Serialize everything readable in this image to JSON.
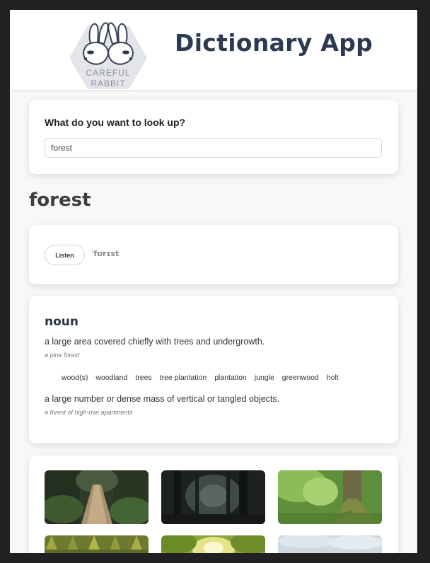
{
  "header": {
    "logo": {
      "top_text": "CAREFUL",
      "bottom_text": "RABBIT"
    },
    "title": "Dictionary App"
  },
  "search": {
    "label": "What do you want to look up?",
    "value": "forest"
  },
  "result": {
    "word": "forest",
    "listen_label": "Listen",
    "phonetic": "ˈfɒrɪst",
    "part_of_speech": "noun",
    "definitions": [
      {
        "text": "a large area covered chiefly with trees and undergrowth.",
        "example": "a pine forest"
      },
      {
        "text": "a large number or dense mass of vertical or tangled objects.",
        "example": "a forest of high-rise apartments"
      }
    ],
    "synonyms": [
      "wood(s)",
      "woodland",
      "trees",
      "tree plantation",
      "plantation",
      "jungle",
      "greenwood",
      "holt"
    ]
  },
  "images": [
    {
      "name": "forest-boardwalk-photo"
    },
    {
      "name": "dark-misty-forest-photo"
    },
    {
      "name": "mossy-tree-roots-photo"
    },
    {
      "name": "pine-treetops-photo"
    },
    {
      "name": "sunlit-canopy-photo"
    },
    {
      "name": "pale-sky-forest-photo"
    }
  ]
}
